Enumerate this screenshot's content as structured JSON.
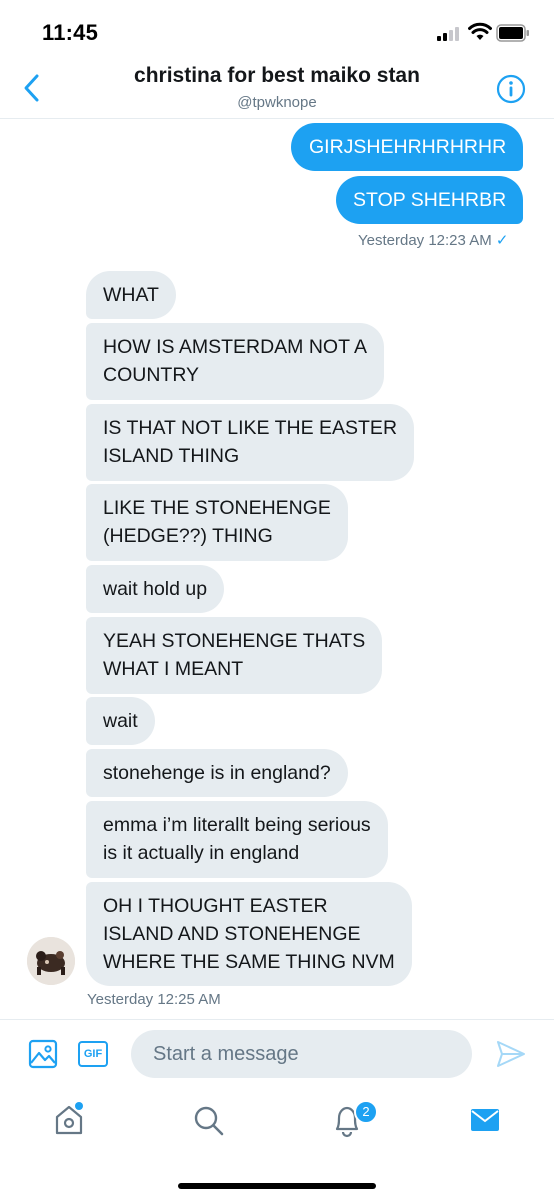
{
  "status_bar": {
    "time": "11:45"
  },
  "header": {
    "title": "christina for best maiko stan",
    "handle": "@tpwknope"
  },
  "outgoing": {
    "messages": [
      "GIRJSHEHRHRHRHR",
      "STOP SHEHRBR"
    ],
    "timestamp": "Yesterday 12:23 AM",
    "read_mark": "✓"
  },
  "incoming": {
    "messages": [
      "WHAT",
      "HOW IS AMSTERDAM NOT A\nCOUNTRY",
      "IS THAT NOT LIKE THE EASTER\nISLAND THING",
      "LIKE THE STONEHENGE\n(HEDGE??) THING",
      "wait hold up",
      "YEAH STONEHENGE THATS\nWHAT I MEANT",
      "wait",
      "stonehenge is in england?",
      "emma i’m literallt being serious\nis it actually in england",
      "OH I THOUGHT EASTER\nISLAND AND STONEHENGE\nWHERE THE SAME THING NVM"
    ],
    "timestamp": "Yesterday 12:25 AM"
  },
  "composer": {
    "placeholder": "Start a message",
    "gif_label": "GIF"
  },
  "tab_bar": {
    "notifications_badge": "2",
    "active_tab": "messages"
  },
  "colors": {
    "accent": "#1da1f2",
    "incoming_bubble": "#e6ecf0",
    "secondary_text": "#657786"
  },
  "icons": [
    "back-chevron-icon",
    "info-icon",
    "image-icon",
    "gif-icon",
    "send-icon",
    "home-icon",
    "search-icon",
    "bell-icon",
    "mail-icon"
  ]
}
